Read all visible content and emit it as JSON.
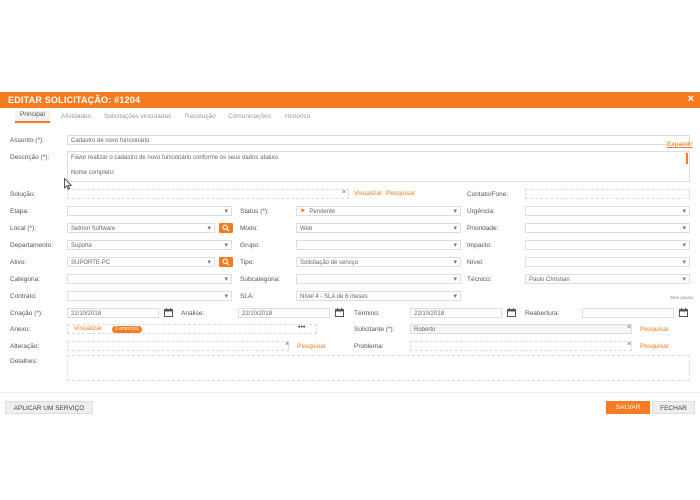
{
  "header": {
    "title": "EDITAR SOLICITAÇÃO: #1204",
    "close_glyph": "×"
  },
  "tabs": [
    {
      "label": "Principal",
      "active": true
    },
    {
      "label": "Atividades"
    },
    {
      "label": "Solicitações vinculadas"
    },
    {
      "label": "Resolução"
    },
    {
      "label": "Comunicações"
    },
    {
      "label": "Histórico"
    }
  ],
  "form": {
    "assunto": {
      "label": "Assunto (*):",
      "value": "Cadastro de novo funcionário"
    },
    "expandir": "Expandir",
    "descricao": {
      "label": "Descrição (*):",
      "line1": "Favor realizar o cadastro de novo funcionário conforme os seus dados abaixo.",
      "line2": "Nome completo:"
    },
    "solucao": {
      "label": "Solução:",
      "visualizar": "Visualizar",
      "pesquisar": "Pesquisar"
    },
    "contato": {
      "label": "Contato/Fone:"
    },
    "etapa": {
      "label": "Etapa:"
    },
    "status": {
      "label": "Status (*):",
      "value": "Pendente",
      "flag_color": "#f47b20"
    },
    "urgencia": {
      "label": "Urgência:"
    },
    "local": {
      "label": "Local (*):",
      "value": "Setrion Software"
    },
    "modo": {
      "label": "Modo:",
      "value": "Web"
    },
    "prioridade": {
      "label": "Prioridade:"
    },
    "departamento": {
      "label": "Departamento:",
      "value": "Suporte"
    },
    "grupo": {
      "label": "Grupo:"
    },
    "impacto": {
      "label": "Impacto:"
    },
    "ativo": {
      "label": "Ativo:",
      "value": "SUPORTE-PC"
    },
    "tipo": {
      "label": "Tipo:",
      "value": "Solicitação de serviço"
    },
    "nivel": {
      "label": "Nível:"
    },
    "categoria": {
      "label": "Categoria:"
    },
    "subcategoria": {
      "label": "Subcategoria:"
    },
    "tecnico": {
      "label": "Técnico:",
      "value": "Paulo Christian"
    },
    "contrato": {
      "label": "Contrato:"
    },
    "sla": {
      "label": "SLA:",
      "value": "Nível 4 - SLA de 6 meses"
    },
    "sem_pausa": "Sem pausa",
    "criacao": {
      "label": "Criação (*):",
      "value": "22/10/2018"
    },
    "analise": {
      "label": "Análise:",
      "value": "22/10/2018"
    },
    "termino": {
      "label": "Término:",
      "value": "22/10/2018"
    },
    "reabertura": {
      "label": "Reabertura:"
    },
    "anexo": {
      "label": "Anexo:",
      "visualizar": "Visualizar",
      "badge": "1 anexo(s)",
      "more": "•••"
    },
    "solicitante": {
      "label": "Solicitante (*):",
      "value": "Roberto",
      "pesquisar": "Pesquisar"
    },
    "alteracao": {
      "label": "Alteração:",
      "pesquisar": "Pesquisar"
    },
    "problema": {
      "label": "Problema:",
      "pesquisar": "Pesquisar"
    },
    "detalhes": {
      "label": "Detalhes:"
    }
  },
  "footer": {
    "apply_label": "APLICAR UM SERVIÇO",
    "save_label": "SALVAR",
    "close_label": "FECHAR"
  },
  "colors": {
    "accent": "#f47b20"
  }
}
